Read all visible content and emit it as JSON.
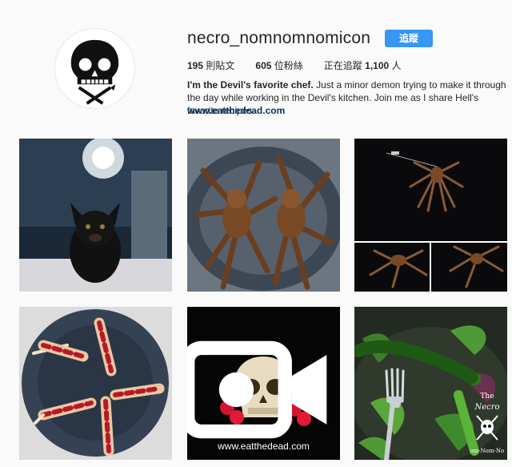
{
  "profile": {
    "username": "necro_nomnomnomicon",
    "follow_label": "追蹤",
    "posts_count": "195",
    "posts_label": "則貼文",
    "followers_count": "605",
    "followers_label": "位粉絲",
    "following_prefix": "正在追蹤",
    "following_count": "1,100",
    "following_suffix": "人",
    "bio_name": "I'm the Devil's favorite chef.",
    "bio_text": " Just a minor demon trying to make it through the day while working in the Devil's kitchen.  Join me as I share Hell's favorite recipes.",
    "website": "www.eatthedead.com"
  },
  "posts": [
    {
      "name": "dog-photo"
    },
    {
      "name": "tarantulas-plate"
    },
    {
      "name": "spider-collage"
    },
    {
      "name": "finger-popsicles"
    },
    {
      "name": "skull-video",
      "watermark": "www.eatthedead.com",
      "icon": "video-camera-icon"
    },
    {
      "name": "salad-fork",
      "logo_text": "The Necro Nom-Nom-Nom"
    }
  ],
  "colors": {
    "accent": "#3897f0",
    "link": "#003569",
    "background": "#fafafa"
  }
}
